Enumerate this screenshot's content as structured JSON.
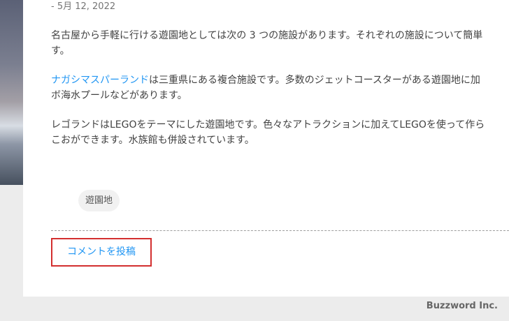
{
  "post": {
    "date": "- 5月 12, 2022",
    "paragraph1_line1": "名古屋から手軽に行ける遊園地としては次の 3 つの施設があります。それぞれの施設について簡単",
    "paragraph1_line2": "す。",
    "paragraph2_link": "ナガシマスパーランド",
    "paragraph2_line1_rest": "は三重県にある複合施設です。多数のジェットコースターがある遊園地に加",
    "paragraph2_line2": "ボ海水プールなどがあります。",
    "paragraph3_line1": "レゴランドはLEGOをテーマにした遊園地です。色々なアトラクションに加えてLEGOを使って作ら",
    "paragraph3_line2": "こおができます。水族館も併設されています。",
    "tag": "遊園地",
    "comment_button": "コメントを投稿"
  },
  "footer": {
    "brand": "Buzzword Inc."
  },
  "colors": {
    "link": "#2196f3",
    "highlight_border": "#d32f2f",
    "page_background": "#ececec"
  }
}
